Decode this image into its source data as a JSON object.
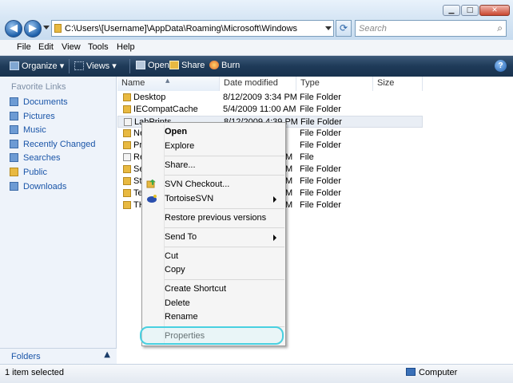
{
  "address": {
    "path": "C:\\Users\\[Username]\\AppData\\Roaming\\Microsoft\\Windows"
  },
  "search": {
    "placeholder": "Search"
  },
  "menubar": [
    "File",
    "Edit",
    "View",
    "Tools",
    "Help"
  ],
  "commands": {
    "organize": "Organize",
    "views": "Views",
    "open": "Open",
    "share": "Share",
    "burn": "Burn"
  },
  "sidebar": {
    "title": "Favorite Links",
    "items": [
      {
        "label": "Documents"
      },
      {
        "label": "Pictures"
      },
      {
        "label": "Music"
      },
      {
        "label": "Recently Changed"
      },
      {
        "label": "Searches"
      },
      {
        "label": "Public"
      },
      {
        "label": "Downloads"
      }
    ],
    "folders_label": "Folders"
  },
  "columns": {
    "name": "Name",
    "date": "Date modified",
    "type": "Type",
    "size": "Size"
  },
  "files": [
    {
      "name": "Desktop",
      "date": "8/12/2009 3:34 PM",
      "type": "File Folder"
    },
    {
      "name": "IECompatCache",
      "date": "5/4/2009 11:00 AM",
      "type": "File Folder"
    },
    {
      "name": "LabPrints",
      "date": "8/12/2009 4:39 PM",
      "type": "File Folder"
    },
    {
      "name": "Ne",
      "date": "",
      "type": "File Folder"
    },
    {
      "name": "Pr",
      "date": "",
      "type": "File Folder"
    },
    {
      "name": "Re",
      "date": "M",
      "type": "File"
    },
    {
      "name": "Se",
      "date": "M",
      "type": "File Folder"
    },
    {
      "name": "Sta",
      "date": "M",
      "type": "File Folder"
    },
    {
      "name": "Te",
      "date": "M",
      "type": "File Folder"
    },
    {
      "name": "TH",
      "date": "M",
      "type": "File Folder"
    }
  ],
  "context_menu": {
    "open": "Open",
    "explore": "Explore",
    "share": "Share...",
    "svn_checkout": "SVN Checkout...",
    "tortoise": "TortoiseSVN",
    "restore": "Restore previous versions",
    "send_to": "Send To",
    "cut": "Cut",
    "copy": "Copy",
    "create_shortcut": "Create Shortcut",
    "delete": "Delete",
    "rename": "Rename",
    "properties": "Properties"
  },
  "status": {
    "left": "1 item selected",
    "right": "Computer"
  },
  "colors": {
    "accent": "#1a55a8",
    "command_bar": "#1e3a58",
    "highlight_ring": "#48d0e0"
  }
}
